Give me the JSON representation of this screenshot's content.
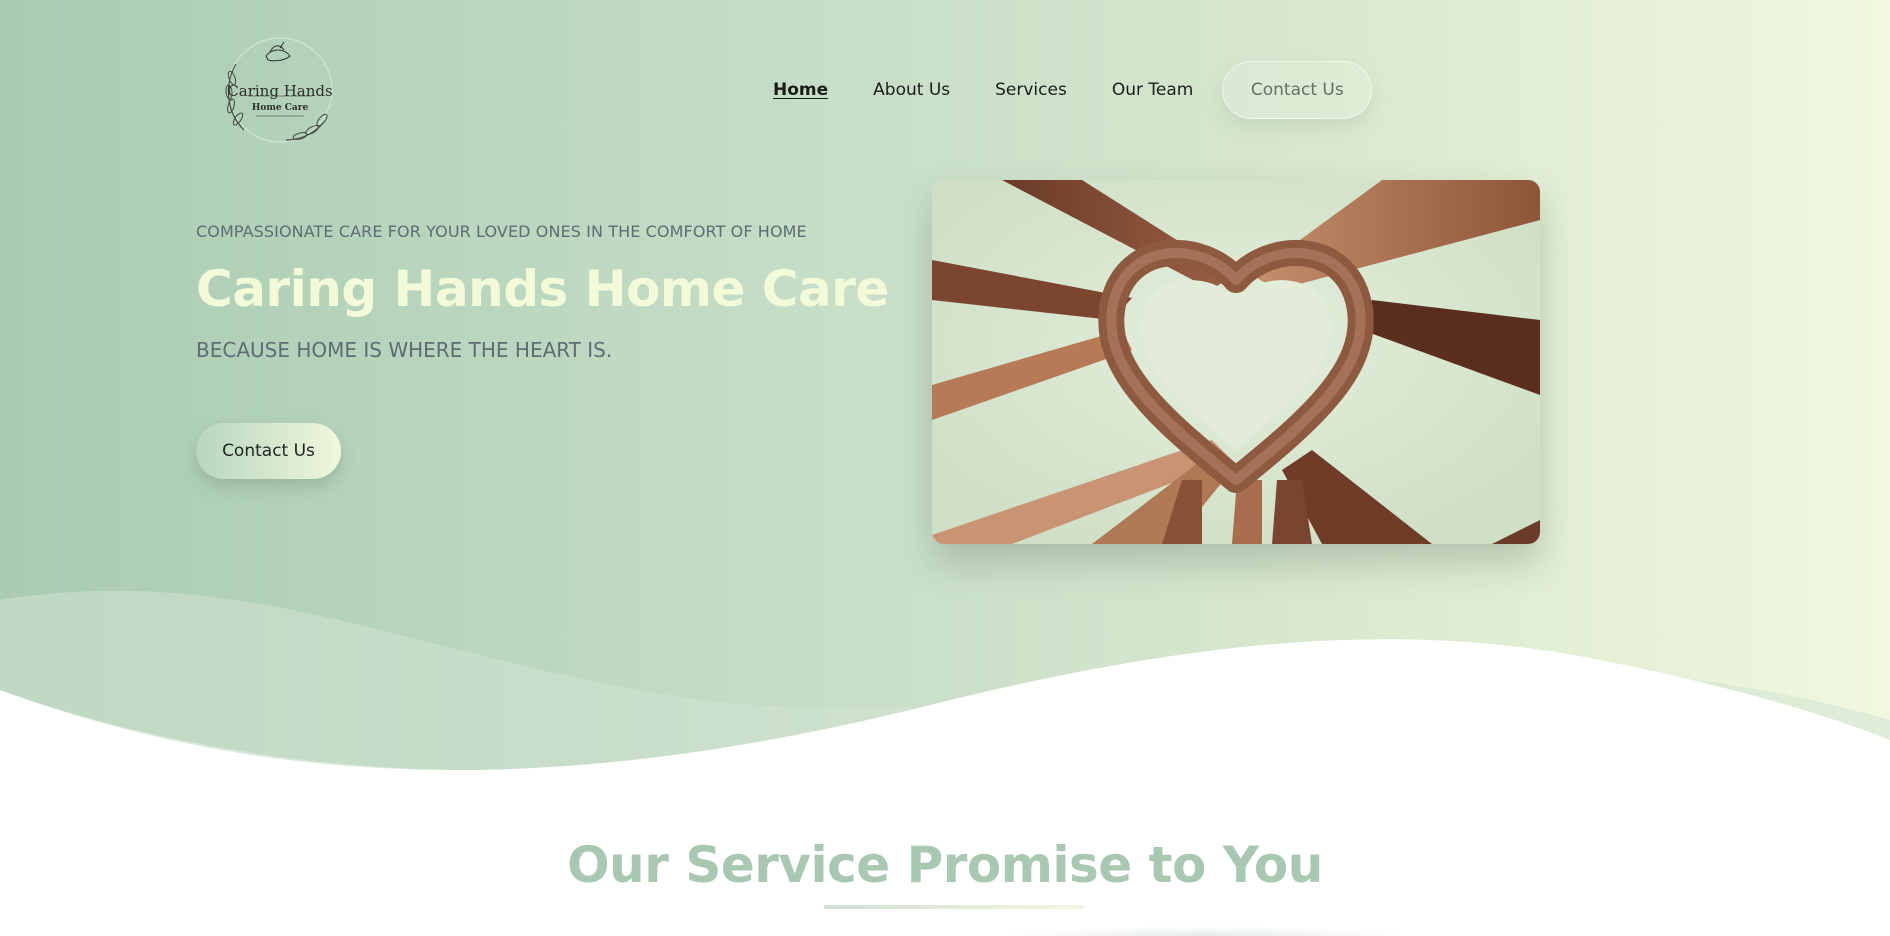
{
  "brand": {
    "logo_line_1": "Caring Hands",
    "logo_line_2": "Home Care"
  },
  "nav": {
    "items": [
      {
        "label": "Home",
        "active": true
      },
      {
        "label": "About Us",
        "active": false
      },
      {
        "label": "Services",
        "active": false
      },
      {
        "label": "Our Team",
        "active": false
      }
    ],
    "contact_label": "Contact Us"
  },
  "hero": {
    "kicker": "COMPASSIONATE CARE FOR YOUR LOVED ONES IN THE COMFORT OF HOME",
    "title": "Caring Hands Home Care",
    "subtitle": "BECAUSE HOME IS WHERE THE HEART IS.",
    "cta_label": "Contact Us",
    "image_icon": "hands-heart-photo"
  },
  "services_section": {
    "title": "Our Service Promise to You"
  },
  "colors": {
    "hero_gradient_start": "#a9cbb2",
    "hero_gradient_end": "#f1f8df",
    "title_cream": "#f3fad8",
    "section_title_green": "#a9c8b1",
    "muted_text": "#5f6c74"
  }
}
